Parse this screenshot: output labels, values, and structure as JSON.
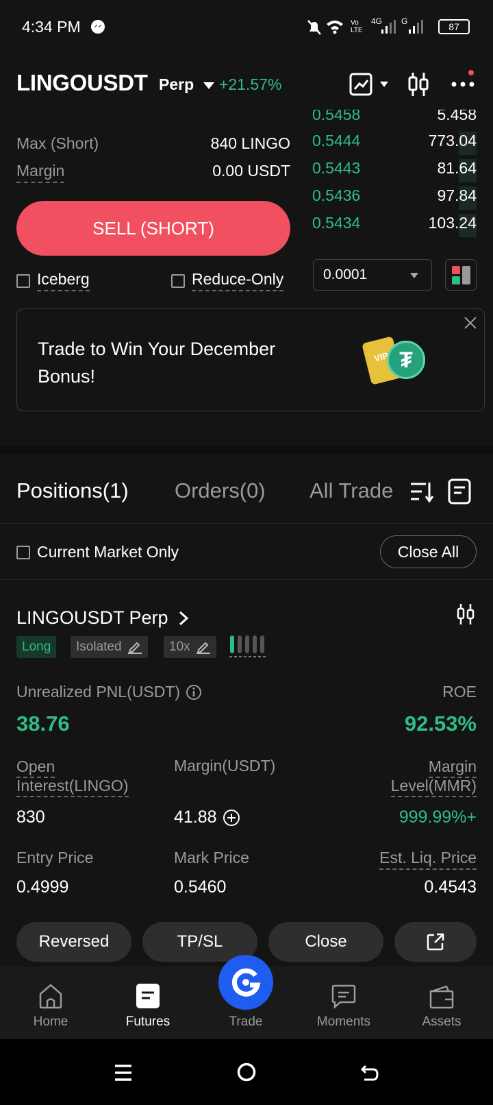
{
  "status_bar": {
    "time": "4:34 PM",
    "battery": "87",
    "net1": "Vo LTE",
    "net2": "4G",
    "net3": "G"
  },
  "header": {
    "pair": "LINGOUSDT",
    "type": "Perp",
    "change": "+21.57%"
  },
  "order_book": {
    "partial_price": "0.5458",
    "partial_qty": "5.458",
    "rows": [
      {
        "price": "0.5444",
        "qty": "773.04"
      },
      {
        "price": "0.5443",
        "qty": "81.64"
      },
      {
        "price": "0.5436",
        "qty": "97.84"
      },
      {
        "price": "0.5434",
        "qty": "103.24"
      }
    ],
    "precision": "0.0001"
  },
  "form": {
    "max_short_label": "Max (Short)",
    "max_short_value": "840 LINGO",
    "margin_label": "Margin",
    "margin_value": "0.00 USDT",
    "sell_button": "SELL (SHORT)",
    "iceberg": "Iceberg",
    "reduce_only": "Reduce-Only"
  },
  "banner": {
    "text": "Trade to Win Your December Bonus!",
    "badge": "VIP"
  },
  "tabs": {
    "positions": "Positions(1)",
    "orders": "Orders(0)",
    "all_trades": "All Trade"
  },
  "filter": {
    "current_market": "Current Market Only",
    "close_all": "Close All"
  },
  "position": {
    "symbol": "LINGOUSDT Perp",
    "side": "Long",
    "margin_mode": "Isolated",
    "leverage": "10x",
    "pnl_label": "Unrealized PNL(USDT)",
    "pnl": "38.76",
    "roe_label": "ROE",
    "roe": "92.53%",
    "oi_label": "Open Interest(LINGO)",
    "oi": "830",
    "margin_label": "Margin(USDT)",
    "margin": "41.88",
    "ml_label": "Margin Level(MMR)",
    "ml": "999.99%+",
    "entry_label": "Entry Price",
    "entry": "0.4999",
    "mark_label": "Mark Price",
    "mark": "0.5460",
    "liq_label": "Est. Liq. Price",
    "liq": "0.4543"
  },
  "actions": {
    "reversed": "Reversed",
    "tpsl": "TP/SL",
    "close": "Close"
  },
  "nav": {
    "home": "Home",
    "futures": "Futures",
    "trade": "Trade",
    "moments": "Moments",
    "assets": "Assets"
  },
  "colors": {
    "green": "#2ebd85",
    "red": "#f0505f",
    "blue": "#1f5cf0",
    "bg": "#141414"
  }
}
